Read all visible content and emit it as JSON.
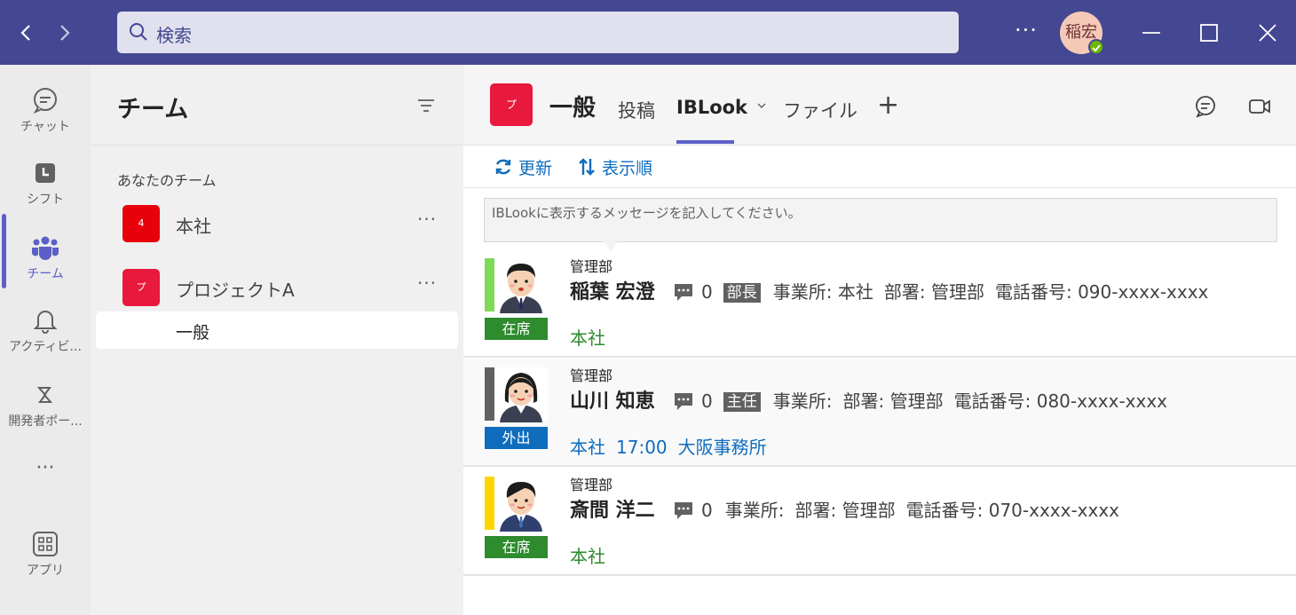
{
  "titlebar": {
    "back_icon": "chevron-left-icon",
    "forward_icon": "chevron-right-icon",
    "search_placeholder": "検索",
    "more": "···",
    "avatar_text": "稲宏",
    "status_color": "#6bb700",
    "bg_color": "#444791"
  },
  "rail": {
    "items": [
      {
        "label": "チャット",
        "icon": "chat-icon"
      },
      {
        "label": "シフト",
        "icon": "shifts-icon"
      },
      {
        "label": "チーム",
        "icon": "teams-icon"
      },
      {
        "label": "アクティビ...",
        "icon": "bell-icon"
      },
      {
        "label": "開発者ポー...",
        "icon": "developer-portal-icon"
      },
      {
        "label": "···",
        "icon": "more-icon"
      },
      {
        "label": "アプリ",
        "icon": "apps-icon"
      }
    ],
    "active_index": 2
  },
  "teams_panel": {
    "title": "チーム",
    "section_label": "あなたのチーム",
    "teams": [
      {
        "name": "本社",
        "tile_text": "4",
        "tile_color": "#e8000b",
        "more": "···"
      },
      {
        "name": "プロジェクトA",
        "tile_text": "プ",
        "tile_color": "#e8193c",
        "more": "···"
      }
    ],
    "channel": "一般"
  },
  "channel_header": {
    "tile_text": "プ",
    "title": "一般",
    "tabs": [
      "投稿",
      "IBLook",
      "ファイル"
    ],
    "active_tab": "IBLook",
    "add_tab": "+"
  },
  "toolbar": {
    "refresh": "更新",
    "sort": "表示順"
  },
  "message_box": {
    "placeholder": "IBLookに表示するメッセージを記入してください。"
  },
  "people": [
    {
      "department": "管理部",
      "name": "稲葉 宏澄",
      "chat_count": "0",
      "role": "部長",
      "office": "事業所: 本社",
      "division": "部署: 管理部",
      "phone": "電話番号: 090-xxxx-xxxx",
      "status": "在席",
      "status_color": "#2e8b2e",
      "bar_color": "#7ed957",
      "location": "本社",
      "time": "",
      "destination": "",
      "location_color": "#2e8b2e"
    },
    {
      "department": "管理部",
      "name": "山川 知恵",
      "chat_count": "0",
      "role": "主任",
      "office": "事業所:",
      "division": "部署: 管理部",
      "phone": "電話番号: 080-xxxx-xxxx",
      "status": "外出",
      "status_color": "#0f6cbd",
      "bar_color": "#616161",
      "location": "本社",
      "time": "17:00",
      "destination": "大阪事務所",
      "location_color": "#0f6cbd"
    },
    {
      "department": "管理部",
      "name": "斎間 洋二",
      "chat_count": "0",
      "role": "",
      "office": "事業所:",
      "division": "部署: 管理部",
      "phone": "電話番号: 070-xxxx-xxxx",
      "status": "在席",
      "status_color": "#2e8b2e",
      "bar_color": "#ffd400",
      "location": "本社",
      "time": "",
      "destination": "",
      "location_color": "#2e8b2e"
    }
  ]
}
